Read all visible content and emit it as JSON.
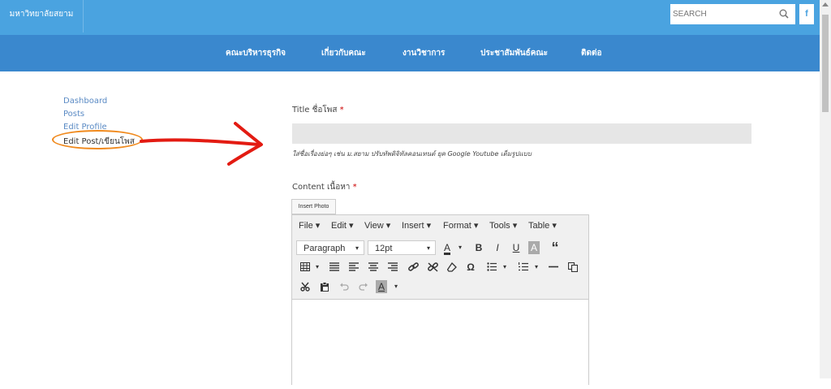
{
  "header": {
    "brand": "มหาวิทยาลัยสยาม",
    "search_placeholder": "SEARCH",
    "facebook_label": "f"
  },
  "nav": {
    "items": [
      "คณะบริหารธุรกิจ",
      "เกี่ยวกับคณะ",
      "งานวิชาการ",
      "ประชาสัมพันธ์คณะ",
      "ติดต่อ"
    ]
  },
  "sidebar": {
    "items": [
      "Dashboard",
      "Posts",
      "Edit Profile",
      "Edit Post/เขียนโพส"
    ]
  },
  "form": {
    "title_label": "Title ชื่อโพส",
    "required_mark": "*",
    "title_value": "",
    "title_hint": "ใส่ชื่อเรื่องย่อๆ เช่น ม.สยาม ปรับทัพดิจิทัลคอนเทนต์ ยุค Google Youtube เต็มรูปแบบ",
    "content_label": "Content เนื้อหา",
    "insert_photo": "Insert Photo"
  },
  "editor": {
    "menu": [
      "File ▾",
      "Edit ▾",
      "View ▾",
      "Insert ▾",
      "Format ▾",
      "Tools ▾",
      "Table ▾"
    ],
    "format_select": "Paragraph",
    "size_select": "12pt",
    "caret": "▾",
    "bold": "B",
    "italic": "I",
    "underline": "U",
    "bg_color": "A",
    "quote": "“",
    "text_color": "A",
    "omega": "Ω",
    "font_color2": "A"
  },
  "colors": {
    "header_bg": "#4aa3e0",
    "nav_bg": "#3a88ce",
    "annotation_circle": "#f08a1e",
    "annotation_arrow": "#e31b12"
  }
}
